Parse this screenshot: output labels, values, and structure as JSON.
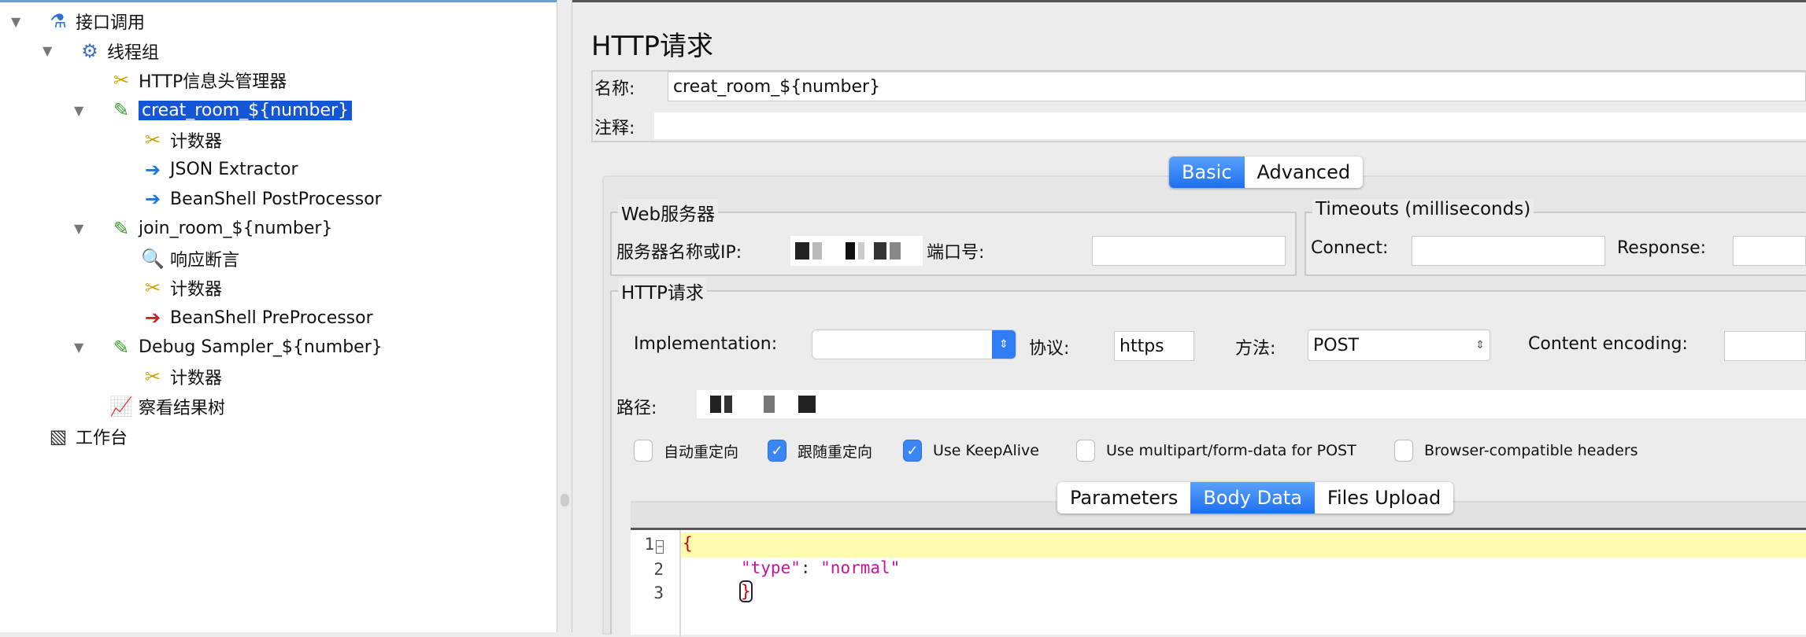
{
  "tree": {
    "items": [
      {
        "label": "接口调用",
        "icon": "test-plan-flask-icon",
        "expanded": true
      },
      {
        "label": "线程组",
        "icon": "thread-group-gear-icon",
        "expanded": true
      },
      {
        "label": "HTTP信息头管理器",
        "icon": "config-tools-icon"
      },
      {
        "label": "creat_room_${number}",
        "icon": "sampler-pipette-icon",
        "expanded": true,
        "selected": true
      },
      {
        "label": "计数器",
        "icon": "config-tools-icon"
      },
      {
        "label": "JSON Extractor",
        "icon": "post-processor-icon"
      },
      {
        "label": "BeanShell PostProcessor",
        "icon": "post-processor-icon"
      },
      {
        "label": "join_room_${number}",
        "icon": "sampler-pipette-icon",
        "expanded": true
      },
      {
        "label": "响应断言",
        "icon": "assertion-magnifier-icon"
      },
      {
        "label": "计数器",
        "icon": "config-tools-icon"
      },
      {
        "label": "BeanShell PreProcessor",
        "icon": "pre-processor-icon"
      },
      {
        "label": "Debug Sampler_${number}",
        "icon": "sampler-pipette-icon",
        "expanded": true
      },
      {
        "label": "计数器",
        "icon": "config-tools-icon"
      },
      {
        "label": "察看结果树",
        "icon": "listener-graph-icon"
      },
      {
        "label": "工作台",
        "icon": "workbench-icon"
      }
    ]
  },
  "panel": {
    "title": "HTTP请求",
    "name_label": "名称:",
    "name_value": "creat_room_${number}",
    "comment_label": "注释:",
    "comment_value": "",
    "tabs": [
      "Basic",
      "Advanced"
    ],
    "active_tab": "Basic",
    "web_server": {
      "title": "Web服务器",
      "server_label": "服务器名称或IP:",
      "port_label": "端口号:",
      "port_value": ""
    },
    "timeouts": {
      "title": "Timeouts (milliseconds)",
      "connect_label": "Connect:",
      "response_label": "Response:"
    },
    "http": {
      "title": "HTTP请求",
      "implementation_label": "Implementation:",
      "implementation_value": "",
      "protocol_label": "协议:",
      "protocol_value": "https",
      "method_label": "方法:",
      "method_value": "POST",
      "encoding_label": "Content encoding:",
      "path_label": "路径:"
    },
    "checkboxes": [
      {
        "label": "自动重定向",
        "checked": false
      },
      {
        "label": "跟随重定向",
        "checked": true
      },
      {
        "label": "Use KeepAlive",
        "checked": true
      },
      {
        "label": "Use multipart/form-data for POST",
        "checked": false
      },
      {
        "label": "Browser-compatible headers",
        "checked": false
      }
    ],
    "body_tabs": [
      "Parameters",
      "Body Data",
      "Files Upload"
    ],
    "active_body_tab": "Body Data",
    "editor": {
      "line_numbers": [
        "1",
        "2",
        "3"
      ],
      "lines": {
        "l1": "{",
        "key": "\"type\"",
        "colon": ": ",
        "val": "\"normal\"",
        "l3": "}"
      }
    }
  },
  "colors": {
    "selection": "#1456d6",
    "accent": "#1d6ff2",
    "current_line": "#fffbb0",
    "json_string": "#c8139a",
    "brace": "#cc0000"
  }
}
